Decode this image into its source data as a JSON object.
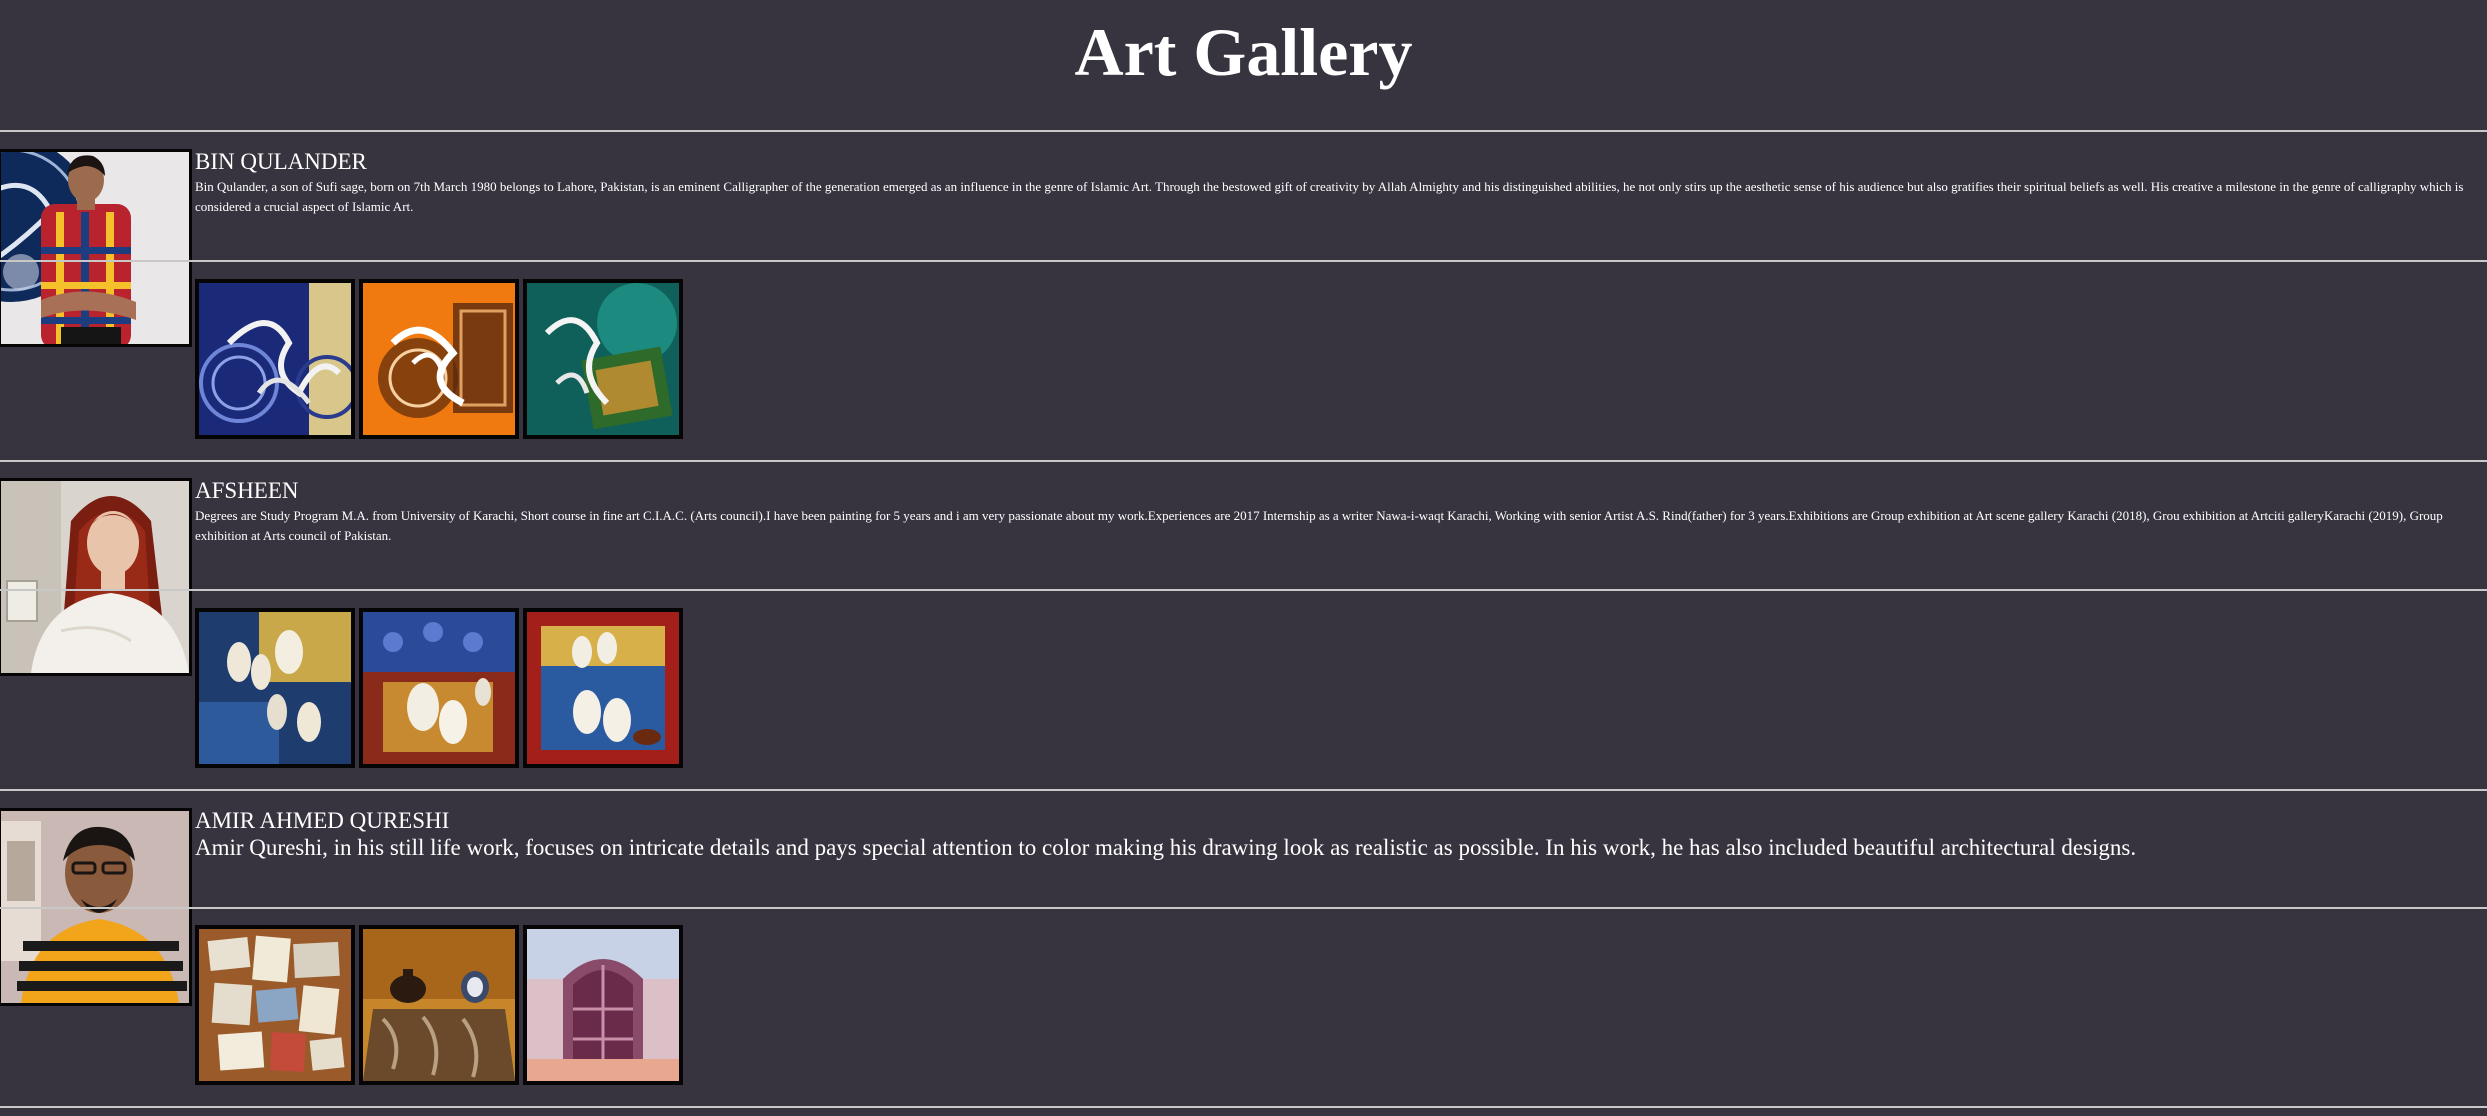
{
  "page": {
    "title": "Art Gallery"
  },
  "artists": [
    {
      "name": "BIN QULANDER",
      "bio": "Bin Qulander, a son of Sufi sage, born on 7th March 1980 belongs to Lahore, Pakistan, is an eminent Calligrapher of the generation emerged as an influence in the genre of Islamic Art. Through the bestowed gift of creativity by Allah Almighty and his distinguished abilities, he not only stirs up the aesthetic sense of his audience but also gratifies their spiritual beliefs as well. His creative a milestone in the genre of calligraphy which is considered a crucial aspect of Islamic Art.",
      "portrait_icon": "portrait-calligrapher",
      "artworks": [
        "calligraphy-blue-gold",
        "calligraphy-orange",
        "calligraphy-teal"
      ]
    },
    {
      "name": "AFSHEEN",
      "bio": "Degrees are Study Program M.A. from University of Karachi, Short course in fine art C.I.A.C. (Arts council).I have been painting for 5 years and i am very passionate about my work.Experiences are 2017 Internship as a writer Nawa-i-waqt Karachi, Working with senior Artist A.S. Rind(father) for 3 years.Exhibitions are Group exhibition at Art scene gallery Karachi (2018), Grou exhibition at Artciti galleryKarachi (2019), Group exhibition at Arts council of Pakistan.",
      "portrait_icon": "portrait-woman-red-hair",
      "artworks": [
        "doves-blue-gold",
        "doves-red-blue",
        "doves-red-frame"
      ]
    },
    {
      "name": "AMIR AHMED QURESHI",
      "bio": "Amir Qureshi, in his still life work, focuses on intricate details and pays special attention to color making his drawing look as realistic as possible. In his work, he has also included beautiful architectural designs.",
      "portrait_icon": "portrait-man-striped-shirt",
      "artworks": [
        "still-life-papers",
        "still-life-pots",
        "door-arch-painting"
      ]
    }
  ],
  "colors": {
    "background": "#37343f",
    "text": "#ffffff",
    "rule": "#c8c8c8",
    "frame": "#050505"
  }
}
